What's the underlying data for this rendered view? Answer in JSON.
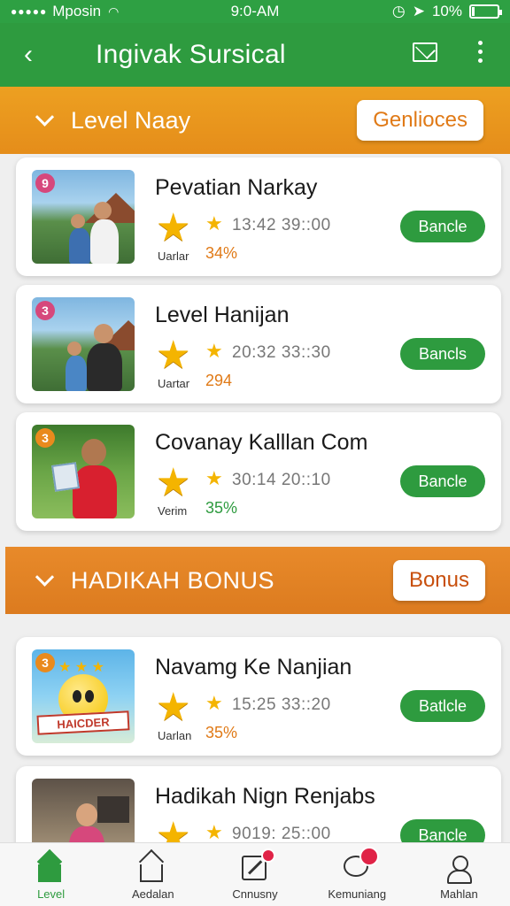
{
  "status_bar": {
    "signal": "●●●●●",
    "carrier": "Mposin",
    "wifi": "wifi-icon",
    "time": "9:0-AM",
    "battery": "10%",
    "battery_level": 0.1
  },
  "app_bar": {
    "title": "Ingivak Sursical",
    "back_icon": "back-arrow-icon",
    "mail_icon": "mail-icon",
    "more_icon": "more-vertical-icon"
  },
  "colors": {
    "green": "#2e9b3f",
    "orange": "#eda021",
    "orange_dark": "#dc7b1f"
  },
  "sections": [
    {
      "label": "Level Naay",
      "button": "Genlioces"
    },
    {
      "label": "HADIKAH BONUS",
      "button": "Bonus"
    }
  ],
  "cards": [
    {
      "badge": "9",
      "badge_color": "#d6487c",
      "name": "Pevatian Narkay",
      "sublabel": "Uarlar",
      "times": "13:42  39::00",
      "pct": "34%",
      "pct_color": "#e07a17",
      "action": "Bancle"
    },
    {
      "badge": "3",
      "badge_color": "#d6487c",
      "name": "Level Hanijan",
      "sublabel": "Uartar",
      "times": "20:32  33::30",
      "pct": "294",
      "pct_color": "#e07a17",
      "action": "Bancls"
    },
    {
      "badge": "3",
      "badge_color": "#e98a1d",
      "name": "Covanay Kalllan Com",
      "sublabel": "Verim",
      "times": "30:14  20::10",
      "pct": "35%",
      "pct_color": "#2e9b3f",
      "action": "Bancle"
    },
    {
      "badge": "3",
      "badge_color": "#e98a1d",
      "name": "Navamg Ke Nanjian",
      "sublabel": "Uarlan",
      "times": "15:25  33::20",
      "pct": "35%",
      "pct_color": "#e07a17",
      "action": "Batlcle",
      "thumb_text": "HAICDER"
    },
    {
      "badge": "",
      "badge_color": "#e98a1d",
      "name": "Hadikah Nign Renjabs",
      "sublabel": "",
      "times": "9019: 25::00",
      "pct": "",
      "pct_color": "#e07a17",
      "action": "Bancle"
    }
  ],
  "bottom_nav": [
    {
      "label": "Level",
      "icon": "home-icon",
      "active": true
    },
    {
      "label": "Aedalan",
      "icon": "home-outline-icon"
    },
    {
      "label": "Cnnusny",
      "icon": "card-icon",
      "badge": true
    },
    {
      "label": "Kemuniang",
      "icon": "chat-icon",
      "badge": true
    },
    {
      "label": "Mahlan",
      "icon": "user-icon"
    }
  ]
}
